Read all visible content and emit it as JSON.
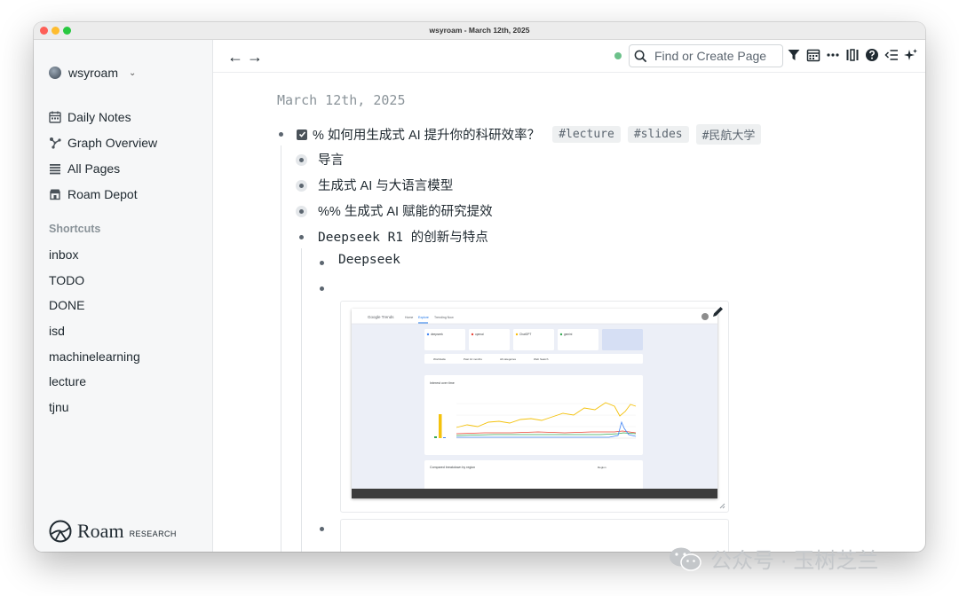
{
  "window": {
    "title": "wsyroam - March 12th, 2025"
  },
  "sidebar": {
    "user": "wsyroam",
    "nav": [
      {
        "label": "Daily Notes",
        "icon": "calendar-icon"
      },
      {
        "label": "Graph Overview",
        "icon": "graph-icon"
      },
      {
        "label": "All Pages",
        "icon": "list-icon"
      },
      {
        "label": "Roam Depot",
        "icon": "store-icon"
      }
    ],
    "shortcuts_title": "Shortcuts",
    "shortcuts": [
      "inbox",
      "TODO",
      "DONE",
      "isd",
      "machinelearning",
      "lecture",
      "tjnu"
    ],
    "brand": {
      "name": "Roam",
      "sub": "RESEARCH"
    }
  },
  "topbar": {
    "search_placeholder": "Find or Create Page",
    "icons": [
      "filter-icon",
      "calendar-icon",
      "more-icon",
      "columns-icon",
      "help-icon",
      "outline-icon",
      "sparkle-icon"
    ],
    "status_color": "#6cc18a"
  },
  "page": {
    "title": "March 12th, 2025",
    "todo": {
      "text": "% 如何用生成式 AI 提升你的科研效率？",
      "tags": [
        "#lecture",
        "#slides",
        "#民航大学"
      ]
    },
    "children": [
      "导言",
      "生成式 AI 与大语言模型",
      "%% 生成式 AI 赋能的研究提效",
      "Deepseek R1 的创新与特点"
    ],
    "sub_children": [
      "Deepseek"
    ]
  },
  "embedded_screenshot": {
    "app": "Google Trends",
    "tabs": [
      "Home",
      "Explore",
      "Trending Now"
    ],
    "terms": [
      "deepseek",
      "openai",
      "ChatGPT",
      "gemini"
    ],
    "filters": [
      "Worldwide",
      "Past 12 months",
      "All categories",
      "Web Search"
    ],
    "chart_title": "Interest over time",
    "region_title": "Compared breakdown by region",
    "region_label": "Region",
    "colors": [
      "#4285f4",
      "#ea4335",
      "#fbbc04",
      "#34a853"
    ]
  },
  "watermark": "公众号 · 玉树芝兰"
}
